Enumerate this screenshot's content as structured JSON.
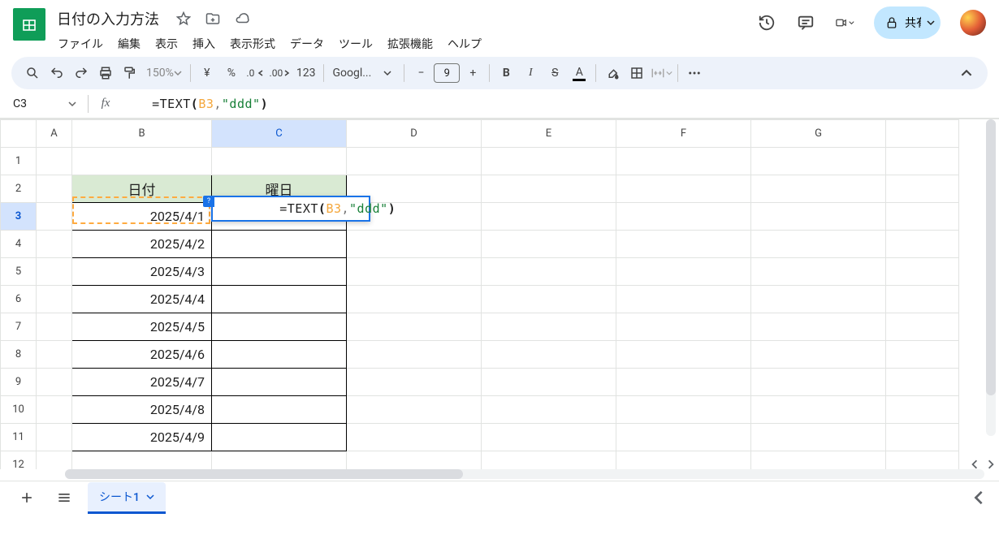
{
  "doc": {
    "title": "日付の入力方法"
  },
  "menus": {
    "file": "ファイル",
    "edit": "編集",
    "view": "表示",
    "insert": "挿入",
    "format": "表示形式",
    "data": "データ",
    "tools": "ツール",
    "extensions": "拡張機能",
    "help": "ヘルプ"
  },
  "header_icons": {
    "history": "history-icon",
    "comments": "comments-icon",
    "meet": "meet-icon"
  },
  "share": {
    "label": "共有"
  },
  "toolbar": {
    "zoom": "150%",
    "currency": "¥",
    "percent": "%",
    "dec_dec": ".0",
    "inc_dec": ".00",
    "numfmt": "123",
    "font": "Googl...",
    "font_size": "9"
  },
  "namebox": {
    "ref": "C3"
  },
  "formula": {
    "raw": "=TEXT(B3,\"ddd\")",
    "eq": "=",
    "fn": "TEXT",
    "lp": "(",
    "ref": "B3",
    "comma": ",",
    "str": "\"ddd\"",
    "rp": ")"
  },
  "columns": [
    "",
    "A",
    "B",
    "C",
    "D",
    "E",
    "F",
    "G",
    ""
  ],
  "rows": [
    "1",
    "2",
    "3",
    "4",
    "5",
    "6",
    "7",
    "8",
    "9",
    "10",
    "11",
    "12"
  ],
  "table": {
    "b_header": "日付",
    "c_header": "曜日",
    "b3": "2025/4/1",
    "b4": "2025/4/2",
    "b5": "2025/4/3",
    "b6": "2025/4/4",
    "b7": "2025/4/5",
    "b8": "2025/4/6",
    "b9": "2025/4/7",
    "b10": "2025/4/8",
    "b11": "2025/4/9"
  },
  "cell_edit": {
    "help_mark": "?"
  },
  "sheettab": {
    "name": "シート1"
  }
}
